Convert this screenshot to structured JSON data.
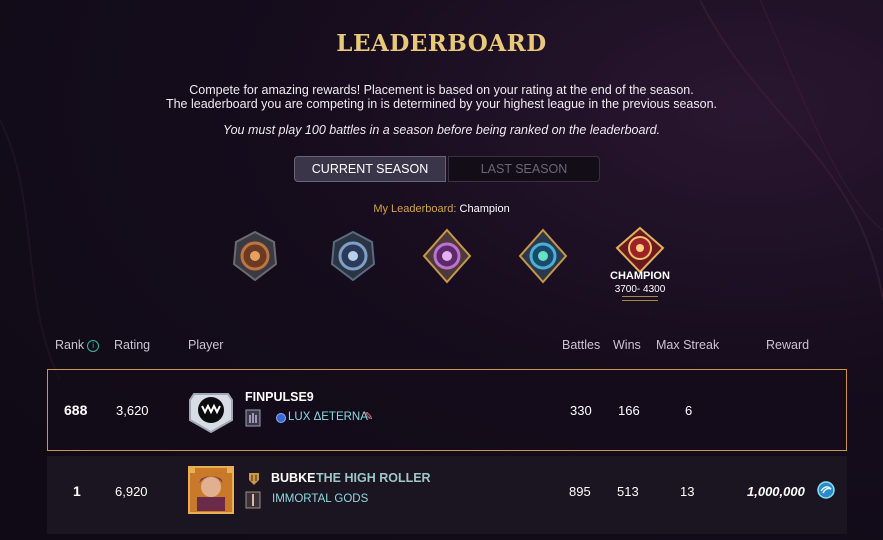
{
  "header": {
    "title": "LEADERBOARD",
    "desc_line1": "Compete for amazing rewards! Placement is based on your rating at the end of the season.",
    "desc_line2": "The leaderboard you are competing in is determined by your highest league in the previous season.",
    "notice": "You must play 100 battles in a season before being ranked on the leaderboard."
  },
  "tabs": {
    "current": "CURRENT SEASON",
    "last": "LAST SEASON",
    "active": "current"
  },
  "my_leaderboard": {
    "label": "My Leaderboard:",
    "value": "Champion"
  },
  "leagues": [
    {
      "icon": "bronze-league-icon",
      "color": "#b0683a"
    },
    {
      "icon": "silver-league-icon",
      "color": "#6f8fb0"
    },
    {
      "icon": "gold-league-icon",
      "color": "#b05ec0"
    },
    {
      "icon": "diamond-league-icon",
      "color": "#3fa0c8"
    },
    {
      "icon": "champion-league-icon",
      "color": "#d8382e",
      "label": "CHAMPION",
      "range": "3700- 4300"
    }
  ],
  "columns": {
    "rank": "Rank",
    "rating": "Rating",
    "player": "Player",
    "battles": "Battles",
    "wins": "Wins",
    "max_streak": "Max Streak",
    "reward": "Reward"
  },
  "my_row": {
    "rank": "688",
    "rating": "3,620",
    "name": "FINPULSE9",
    "guild": "LUX ΔETERNA",
    "battles": "330",
    "wins": "166",
    "max_streak": "6"
  },
  "rows": [
    {
      "rank": "1",
      "rating": "6,920",
      "name": "BUBKE",
      "title": "THE HIGH ROLLER",
      "guild": "IMMORTAL GODS",
      "battles": "895",
      "wins": "513",
      "max_streak": "13",
      "reward": "1,000,000"
    }
  ],
  "colors": {
    "accent_gold": "#e8c97a",
    "highlight_border": "#c9964a",
    "teal": "#3fb6a3"
  }
}
